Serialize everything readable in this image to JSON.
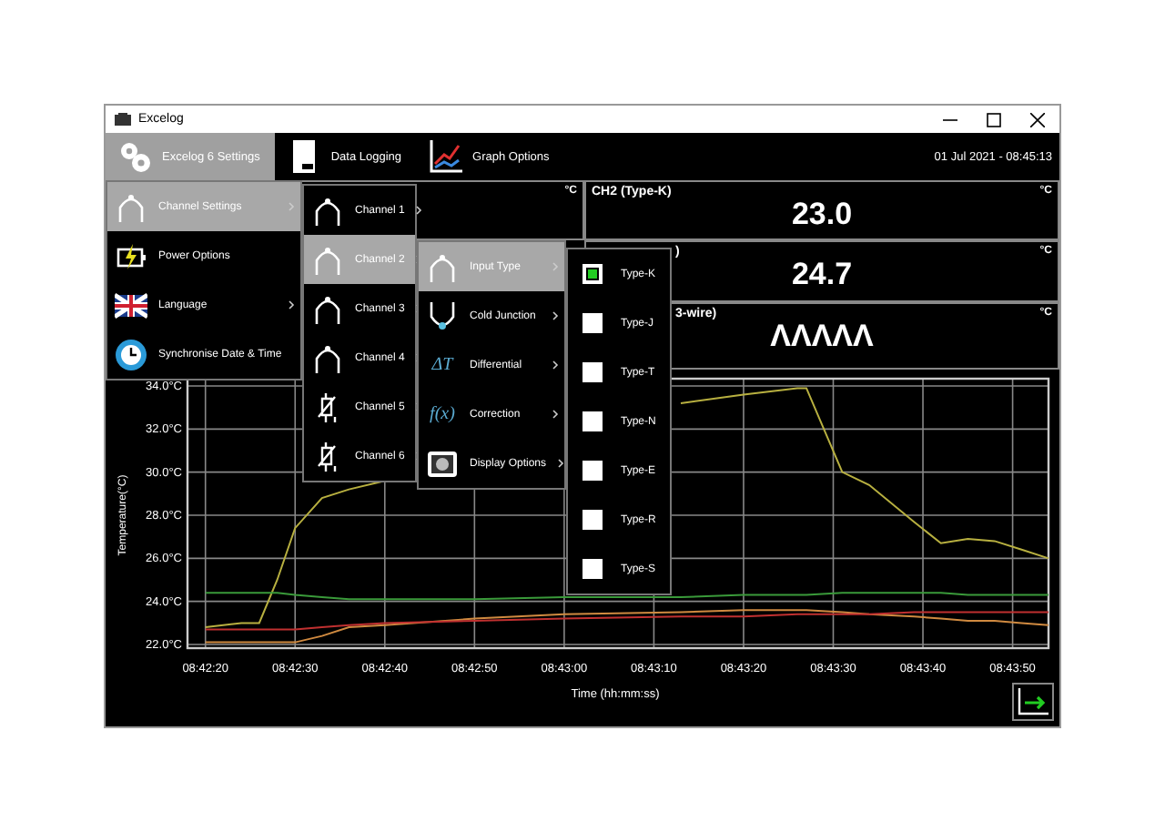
{
  "window": {
    "title": "Excelog"
  },
  "toolbar": {
    "tabs": [
      {
        "label": "Excelog 6 Settings",
        "selected": true
      },
      {
        "label": "Data Logging",
        "selected": false
      },
      {
        "label": "Graph Options",
        "selected": false
      }
    ],
    "datetime": "01 Jul 2021 - 08:45:13"
  },
  "readings": [
    {
      "left": {
        "unit": "°C"
      },
      "right": {
        "title": "CH2 (Type-K)",
        "unit": "°C",
        "value": "23.0"
      }
    },
    {
      "right": {
        "title": ")",
        "unit": "°C",
        "value": "24.7"
      }
    },
    {
      "right": {
        "title": "3-wire)",
        "unit": "°C",
        "value": "ΛΛΛΛΛ"
      }
    }
  ],
  "settings_menu": {
    "items": [
      {
        "label": "Channel Settings",
        "selected": true,
        "submenu": true
      },
      {
        "label": "Power Options",
        "selected": false,
        "submenu": false
      },
      {
        "label": "Language",
        "selected": false,
        "submenu": true
      },
      {
        "label": "Synchronise Date & Time",
        "selected": false,
        "submenu": false
      }
    ]
  },
  "channel_menu": {
    "items": [
      {
        "label": "Channel 1",
        "selected": false,
        "kind": "thermocouple"
      },
      {
        "label": "Channel 2",
        "selected": true,
        "kind": "thermocouple"
      },
      {
        "label": "Channel 3",
        "selected": false,
        "kind": "thermocouple"
      },
      {
        "label": "Channel 4",
        "selected": false,
        "kind": "thermocouple"
      },
      {
        "label": "Channel 5",
        "selected": false,
        "kind": "rtd"
      },
      {
        "label": "Channel 6",
        "selected": false,
        "kind": "rtd"
      }
    ]
  },
  "channel_options_menu": {
    "items": [
      {
        "label": "Input Type",
        "selected": true,
        "kind": "input"
      },
      {
        "label": "Cold Junction",
        "selected": false,
        "kind": "junction"
      },
      {
        "label": "Differential",
        "selected": false,
        "kind": "symbol",
        "symbol": "ΔT"
      },
      {
        "label": "Correction",
        "selected": false,
        "kind": "symbol",
        "symbol": "f(x)"
      },
      {
        "label": "Display Options",
        "selected": false,
        "kind": "display"
      }
    ]
  },
  "input_type_menu": {
    "items": [
      {
        "label": "Type-K",
        "checked": true
      },
      {
        "label": "Type-J",
        "checked": false
      },
      {
        "label": "Type-T",
        "checked": false
      },
      {
        "label": "Type-N",
        "checked": false
      },
      {
        "label": "Type-E",
        "checked": false
      },
      {
        "label": "Type-R",
        "checked": false
      },
      {
        "label": "Type-S",
        "checked": false
      }
    ]
  },
  "chart": {
    "chart_data": {
      "type": "line",
      "grid": true,
      "xlabel": "Time (hh:mm:ss)",
      "ylabel": "Temperature(°C)",
      "x": [
        31340,
        31344,
        31346,
        31348,
        31350,
        31353,
        31356,
        31360,
        31370,
        31380,
        31393,
        31400,
        31406,
        31407,
        31411,
        31414,
        31419,
        31422,
        31425,
        31428,
        31431,
        31434
      ],
      "xlim": [
        31338,
        31434
      ],
      "ylim": [
        22,
        34
      ],
      "xticks": [
        {
          "value": 31340,
          "label": "08:42:20"
        },
        {
          "value": 31350,
          "label": "08:42:30"
        },
        {
          "value": 31360,
          "label": "08:42:40"
        },
        {
          "value": 31370,
          "label": "08:42:50"
        },
        {
          "value": 31380,
          "label": "08:43:00"
        },
        {
          "value": 31390,
          "label": "08:43:10"
        },
        {
          "value": 31400,
          "label": "08:43:20"
        },
        {
          "value": 31410,
          "label": "08:43:30"
        },
        {
          "value": 31420,
          "label": "08:43:40"
        },
        {
          "value": 31430,
          "label": "08:43:50"
        }
      ],
      "yticks": [
        {
          "value": 22,
          "label": "22.0°C"
        },
        {
          "value": 24,
          "label": "24.0°C"
        },
        {
          "value": 26,
          "label": "26.0°C"
        },
        {
          "value": 28,
          "label": "28.0°C"
        },
        {
          "value": 30,
          "label": "30.0°C"
        },
        {
          "value": 32,
          "label": "32.0°C"
        },
        {
          "value": 34,
          "label": "34.0°C"
        }
      ],
      "series": [
        {
          "color": "#b8b040",
          "values": [
            22.8,
            23.0,
            23.0,
            25.0,
            27.4,
            28.8,
            29.2,
            29.6,
            null,
            null,
            33.2,
            33.6,
            33.9,
            33.9,
            30.0,
            29.4,
            27.7,
            26.7,
            26.9,
            26.8,
            26.4,
            26.0
          ]
        },
        {
          "color": "#3a9a3a",
          "values": [
            24.4,
            24.4,
            24.4,
            24.4,
            24.3,
            24.2,
            24.1,
            24.1,
            24.1,
            24.2,
            24.2,
            24.3,
            24.3,
            24.3,
            24.4,
            24.4,
            24.4,
            24.4,
            24.3,
            24.3,
            24.3,
            24.3
          ]
        },
        {
          "color": "#d08a40",
          "values": [
            22.1,
            22.1,
            22.1,
            22.1,
            22.1,
            22.4,
            22.8,
            22.9,
            23.2,
            23.4,
            23.5,
            23.6,
            23.6,
            23.6,
            23.5,
            23.4,
            23.3,
            23.2,
            23.1,
            23.1,
            23.0,
            22.9
          ]
        },
        {
          "color": "#c03030",
          "values": [
            22.7,
            22.7,
            22.7,
            22.7,
            22.7,
            22.8,
            22.9,
            23.0,
            23.1,
            23.2,
            23.3,
            23.3,
            23.4,
            23.4,
            23.4,
            23.4,
            23.5,
            23.5,
            23.5,
            23.5,
            23.5,
            23.5
          ]
        }
      ]
    }
  }
}
